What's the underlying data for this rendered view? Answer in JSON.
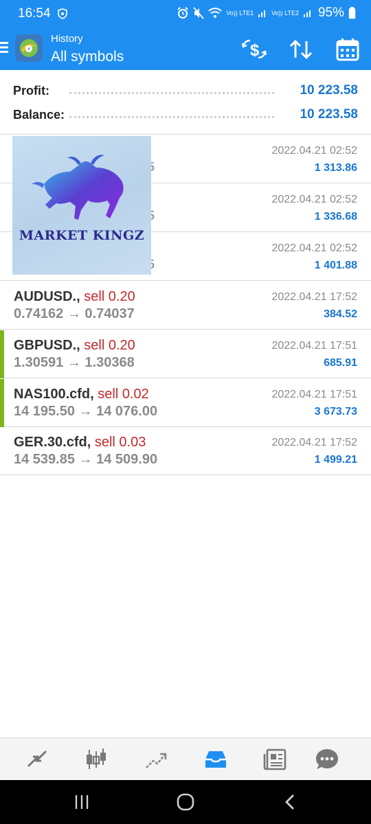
{
  "status_bar": {
    "time": "16:54",
    "battery": "95%",
    "sim1": "Vo)) LTE1",
    "sim2": "Vo)) LTE2"
  },
  "app_bar": {
    "subtitle": "History",
    "title": "All symbols",
    "icons": [
      "currency-exchange-icon",
      "sort-icon",
      "calendar-icon"
    ]
  },
  "summary": {
    "profit_label": "Profit:",
    "profit_value": "10 223.58",
    "balance_label": "Balance:",
    "balance_value": "10 223.58"
  },
  "overlay": {
    "brand_text": "MARKET KINGZ"
  },
  "deals": [
    {
      "symbol": "",
      "side": "",
      "prices": "",
      "peek": "5",
      "time": "2022.04.21 02:52",
      "profit": "1 313.86",
      "marker": false
    },
    {
      "symbol": "",
      "side": "",
      "prices": "",
      "peek": "5",
      "time": "2022.04.21 02:52",
      "profit": "1 336.68",
      "marker": false
    },
    {
      "symbol": "",
      "side": "",
      "prices": "",
      "peek": "5",
      "time": "2022.04.21 02:52",
      "profit": "1 401.88",
      "marker": false
    },
    {
      "symbol": "AUDUSD.,",
      "side": "sell 0.20",
      "prices": "0.74162 → 0.74037",
      "peek": "",
      "time": "2022.04.21 17:52",
      "profit": "384.52",
      "marker": false
    },
    {
      "symbol": "GBPUSD.,",
      "side": "sell 0.20",
      "prices": "1.30591 → 1.30368",
      "peek": "",
      "time": "2022.04.21 17:51",
      "profit": "685.91",
      "marker": true
    },
    {
      "symbol": "NAS100.cfd,",
      "side": "sell 0.02",
      "prices": "14 195.50 → 14 076.00",
      "peek": "",
      "time": "2022.04.21 17:51",
      "profit": "3 673.73",
      "marker": true
    },
    {
      "symbol": "GER.30.cfd,",
      "side": "sell 0.03",
      "prices": "14 539.85 → 14 509.90",
      "peek": "",
      "time": "2022.04.21 17:52",
      "profit": "1 499.21",
      "marker": false
    }
  ],
  "bottom_nav": [
    "quotes-icon",
    "chart-icon",
    "trade-icon",
    "history-icon",
    "news-icon",
    "chat-icon"
  ],
  "bottom_nav_active": "history-icon",
  "colors": {
    "app_bar": "#1f8ef1",
    "profit_blue": "#1976d2",
    "sell_red": "#c62828",
    "marker_green": "#7cb518"
  }
}
